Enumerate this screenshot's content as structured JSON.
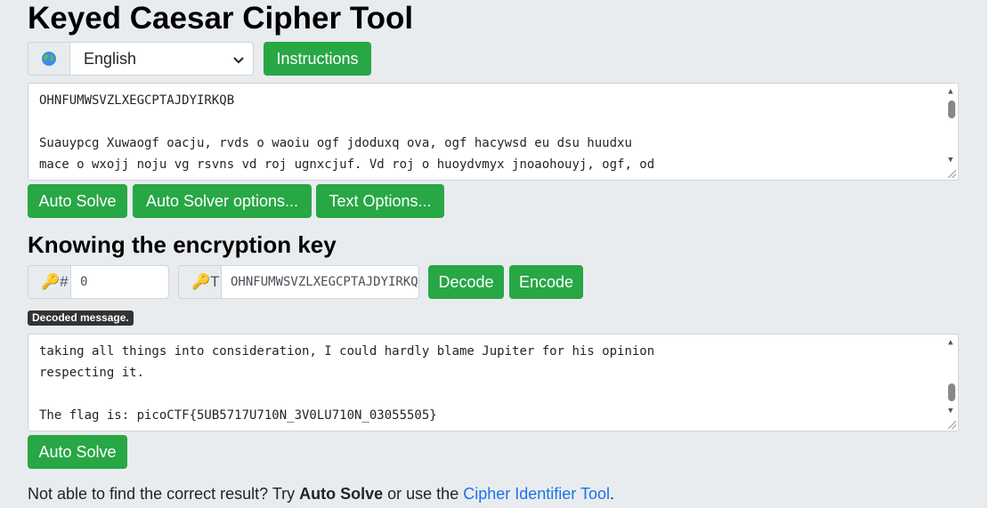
{
  "page": {
    "title": "Keyed Caesar Cipher Tool",
    "section_title": "Knowing the encryption key"
  },
  "language": {
    "icon": "globe-icon",
    "selected": "English"
  },
  "buttons": {
    "instructions": "Instructions",
    "auto_solve": "Auto Solve",
    "auto_solver_options": "Auto Solver options...",
    "text_options": "Text Options...",
    "decode": "Decode",
    "encode": "Encode",
    "auto_solve_2": "Auto Solve"
  },
  "ciphertext": {
    "lines": [
      "OHNFUMWSVZLXEGCPTAJDYIRKQB",
      "",
      "Suauypcg Xuwaogf oacju, rvds o waoiu ogf jdoduxq ova, ogf hacywsd eu dsu huudxu",
      "mace o wxojj noju vg rsvns vd roj ugnxcjuf. Vd roj o huoydvmyx jnoaohouyj, ogf, od"
    ]
  },
  "key": {
    "shift_prefix": "#",
    "shift_value": "0",
    "alphabet_prefix": "T",
    "alphabet_value": "OHNFUMWSVZLXEGCPTAJDYIRKQB"
  },
  "tooltip": "Decoded message.",
  "decoded": {
    "lines": [
      "taking all things into consideration, I could hardly blame Jupiter for his opinion",
      "respecting it.",
      "",
      "The flag is: picoCTF{5UB5717U710N_3V0LU710N_03055505}"
    ]
  },
  "footer": {
    "prefix": "Not able to find the correct result? Try ",
    "bold": "Auto Solve",
    "middle": " or use the ",
    "link": "Cipher Identifier Tool",
    "suffix": "."
  },
  "colors": {
    "accent": "#28a745",
    "link": "#1a73e8",
    "background": "#e9ecef"
  }
}
